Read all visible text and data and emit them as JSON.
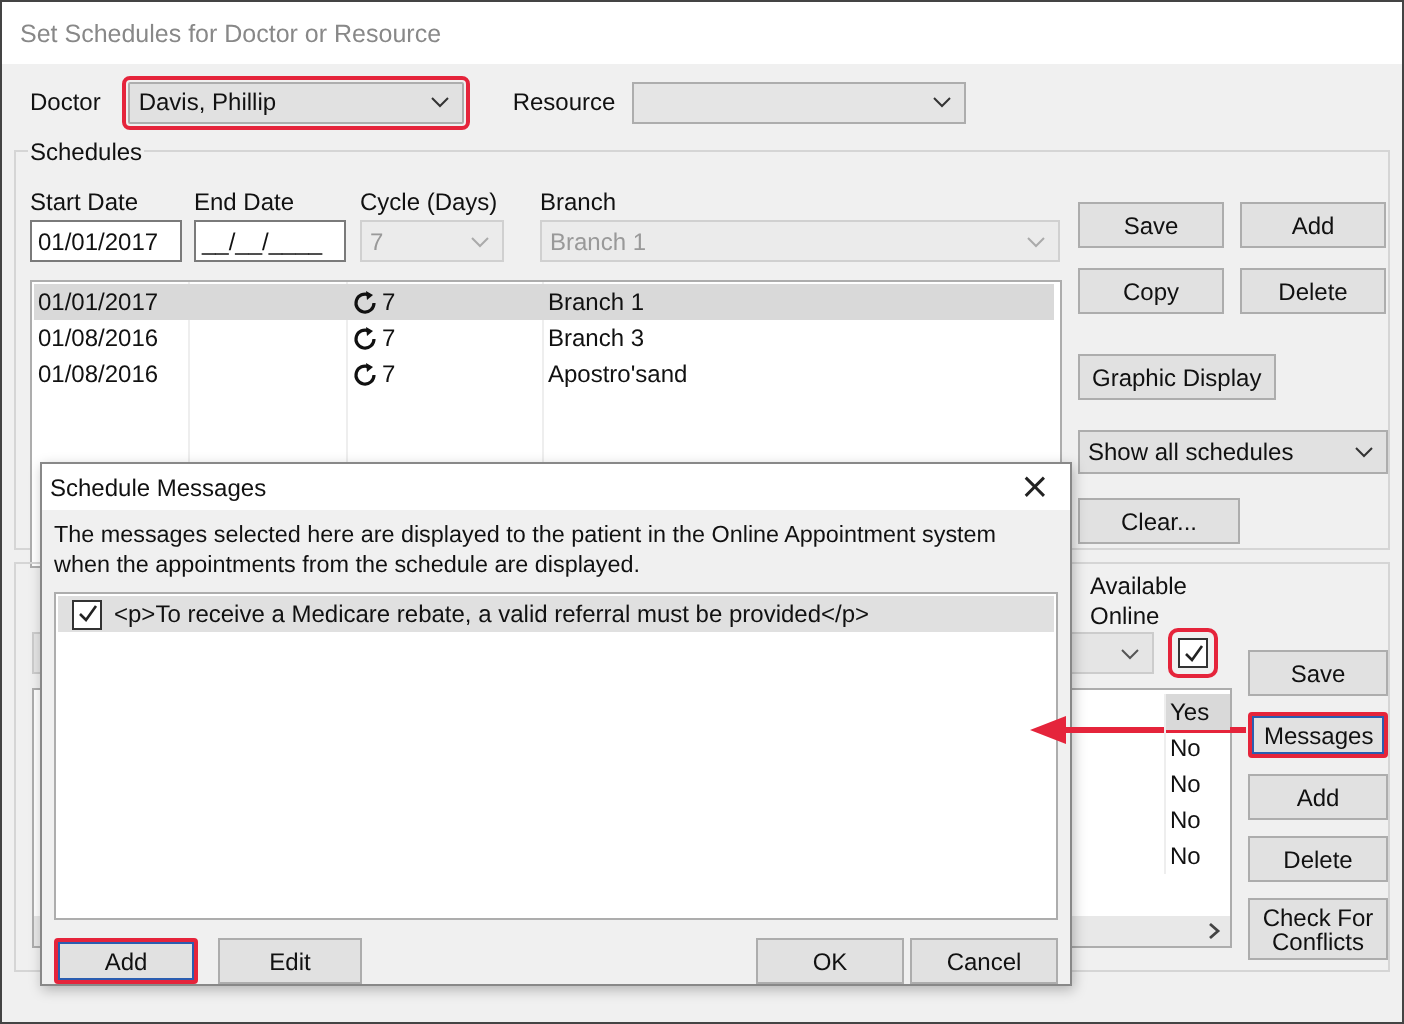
{
  "window": {
    "title": "Set Schedules for Doctor or Resource"
  },
  "doctor": {
    "label": "Doctor",
    "value": "Davis, Phillip",
    "highlighted": true
  },
  "resource": {
    "label": "Resource"
  },
  "schedules": {
    "title": "Schedules",
    "fields": [
      {
        "label": "Start Date",
        "value": "01/01/2017",
        "kind": "text",
        "disabled": false
      },
      {
        "label": "End Date",
        "value": "__/__/____",
        "kind": "text",
        "disabled": false
      },
      {
        "label": "Cycle (Days)",
        "value": "7",
        "kind": "combo",
        "disabled": true
      },
      {
        "label": "Branch",
        "value": "Branch 1",
        "kind": "combo",
        "disabled": true
      }
    ],
    "rows": [
      {
        "start": "01/01/2017",
        "cycle": "7",
        "branch": "Branch 1",
        "selected": true
      },
      {
        "start": "01/08/2016",
        "cycle": "7",
        "branch": "Branch 3",
        "selected": false
      },
      {
        "start": "01/08/2016",
        "cycle": "7",
        "branch": "Apostro'sand",
        "selected": false
      }
    ],
    "buttons": [
      "Save",
      "Add",
      "Copy",
      "Delete"
    ],
    "graphic_display_button": "Graphic Display",
    "filter": "Show all schedules",
    "clear_button": "Clear..."
  },
  "sessions": {
    "available_online": {
      "label": "Available Online",
      "checked": true,
      "highlighted": true
    },
    "rows": [
      {
        "value": "Yes",
        "selected": true
      },
      {
        "value": "No",
        "selected": false
      },
      {
        "value": "No",
        "selected": false
      },
      {
        "value": "No",
        "selected": false
      },
      {
        "value": "No",
        "selected": false
      }
    ],
    "buttons": [
      {
        "label": "Save",
        "highlighted": false
      },
      {
        "label": "Messages",
        "highlighted": true
      },
      {
        "label": "Add",
        "highlighted": false
      },
      {
        "label": "Delete",
        "highlighted": false
      },
      {
        "label": "Check For Conflicts",
        "highlighted": false
      }
    ]
  },
  "dialog": {
    "title": "Schedule Messages",
    "close": "×",
    "description": "The messages selected here are displayed to the patient in the Online Appointment system when the appointments from the schedule are displayed.",
    "messages": [
      {
        "text": "<p>To receive a Medicare rebate, a valid referral must be provided</p>",
        "checked": true,
        "selected": true
      }
    ],
    "left_buttons": [
      {
        "label": "Add",
        "highlighted": true
      },
      {
        "label": "Edit",
        "highlighted": false
      }
    ],
    "right_buttons": [
      {
        "label": "OK",
        "highlighted": false
      },
      {
        "label": "Cancel",
        "highlighted": false
      }
    ]
  }
}
